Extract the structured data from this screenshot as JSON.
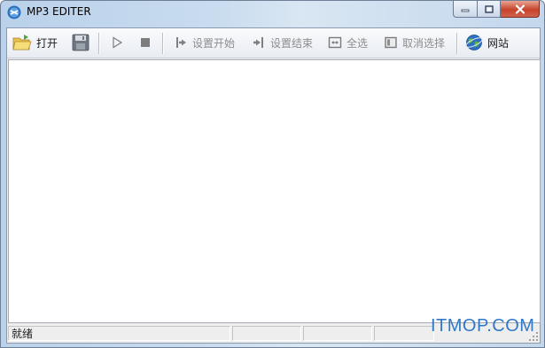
{
  "window": {
    "title": "MP3 EDITER",
    "accent": "#c7442b"
  },
  "caption": {
    "min_icon": "minimize-icon",
    "max_icon": "maximize-icon",
    "close_icon": "close-icon"
  },
  "toolbar": {
    "open_label": "打开",
    "save_icon": "floppy-disk-icon",
    "play_icon": "play-icon",
    "stop_icon": "stop-icon",
    "set_start_label": "设置开始",
    "set_end_label": "设置结束",
    "select_all_label": "全选",
    "cancel_select_label": "取消选择",
    "website_label": "网站"
  },
  "statusbar": {
    "text": "就绪"
  },
  "watermark": {
    "text": "ITMOP.COM"
  }
}
